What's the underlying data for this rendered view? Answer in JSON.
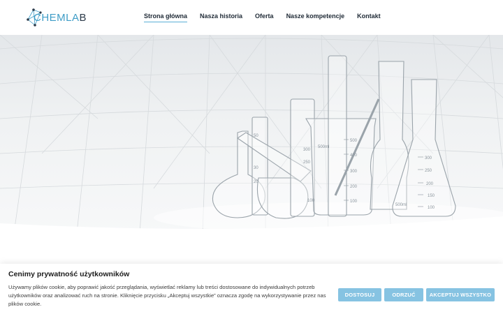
{
  "brand": {
    "logo_text_light": "CHEMLA",
    "logo_text_dark": "B",
    "logo_icon": "molecule-icon"
  },
  "nav": {
    "items": [
      {
        "label": "Strona główna",
        "active": true
      },
      {
        "label": "Nasza historia",
        "active": false
      },
      {
        "label": "Oferta",
        "active": false
      },
      {
        "label": "Nasze kompetencje",
        "active": false
      },
      {
        "label": "Kontakt",
        "active": false
      }
    ],
    "accent_color": "#5aaed6"
  },
  "hero": {
    "image": "laboratory-glassware-image"
  },
  "cookie_banner": {
    "title": "Cenimy prywatność użytkowników",
    "text": "Używamy plików cookie, aby poprawić jakość przeglądania, wyświetlać reklamy lub treści dostosowane do indywidualnych potrzeb użytkowników oraz analizować ruch na stronie. Kliknięcie przycisku „Akceptuj wszystkie” oznacza zgodę na wykorzystywanie przez nas plików cookie.",
    "buttons": {
      "customize": "DOSTOSUJ",
      "reject": "ODRZUĆ",
      "accept_all": "AKCEPTUJ WSZYSTKO"
    },
    "button_color": "#86c3e2"
  }
}
